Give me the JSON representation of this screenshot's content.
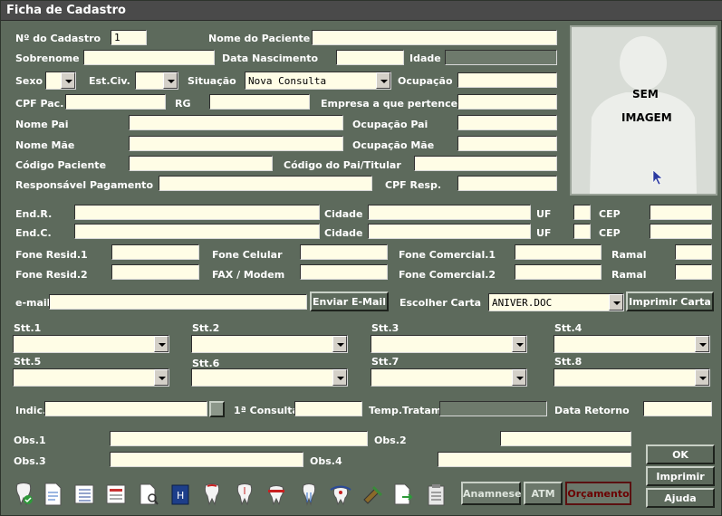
{
  "window": {
    "title": "Ficha de Cadastro"
  },
  "labels": {
    "num_cadastro": "Nº do Cadastro",
    "nome_paciente": "Nome do Paciente",
    "sobrenome": "Sobrenome",
    "data_nascimento": "Data Nascimento",
    "idade": "Idade",
    "sexo": "Sexo",
    "est_civ": "Est.Civ.",
    "situacao": "Situação",
    "ocupacao": "Ocupação",
    "cpf_pac": "CPF Pac.",
    "rg": "RG",
    "empresa": "Empresa a que pertence",
    "nome_pai": "Nome Pai",
    "ocupacao_pai": "Ocupação Pai",
    "nome_mae": "Nome Mãe",
    "ocupacao_mae": "Ocupação Mãe",
    "codigo_paciente": "Código Paciente",
    "codigo_pai_titular": "Código do Pai/Titular",
    "responsavel_pagamento": "Responsável Pagamento",
    "cpf_resp": "CPF Resp.",
    "end_r": "End.R.",
    "end_c": "End.C.",
    "cidade": "Cidade",
    "uf": "UF",
    "cep": "CEP",
    "fone_resid1": "Fone Resid.1",
    "fone_resid2": "Fone Resid.2",
    "fone_celular": "Fone Celular",
    "fax_modem": "FAX / Modem",
    "fone_comercial1": "Fone Comercial.1",
    "fone_comercial2": "Fone Comercial.2",
    "ramal": "Ramal",
    "email": "e-mail",
    "escolher_carta": "Escolher Carta",
    "stt1": "Stt.1",
    "stt2": "Stt.2",
    "stt3": "Stt.3",
    "stt4": "Stt.4",
    "stt5": "Stt.5",
    "stt6": "Stt.6",
    "stt7": "Stt.7",
    "stt8": "Stt.8",
    "indic": "Indic.",
    "primeira_consulta": "1ª Consulta",
    "temp_tratam": "Temp.Tratam",
    "data_retorno": "Data Retorno",
    "obs1": "Obs.1",
    "obs2": "Obs.2",
    "obs3": "Obs.3",
    "obs4": "Obs.4"
  },
  "values": {
    "num_cadastro": "1",
    "situacao": "Nova Consulta",
    "carta": "ANIVER.DOC"
  },
  "photo": {
    "line1": "SEM",
    "line2": "IMAGEM"
  },
  "buttons": {
    "enviar_email": "Enviar E-Mail",
    "imprimir_carta": "Imprimir Carta",
    "ok": "OK",
    "imprimir": "Imprimir",
    "ajuda": "Ajuda",
    "anamnese": "Anamnese",
    "atm": "ATM",
    "orcamento": "Orçamento"
  },
  "toolbar_icons": [
    "tooth-check-icon",
    "document-icon",
    "list-icon",
    "report-icon",
    "document-search-icon",
    "book-icon",
    "tooth-red-icon",
    "tooth-icon",
    "tooth-crown-icon",
    "tooth-root-icon",
    "tooth-brace-icon",
    "tools-icon",
    "document-export-icon",
    "clipboard-icon"
  ]
}
